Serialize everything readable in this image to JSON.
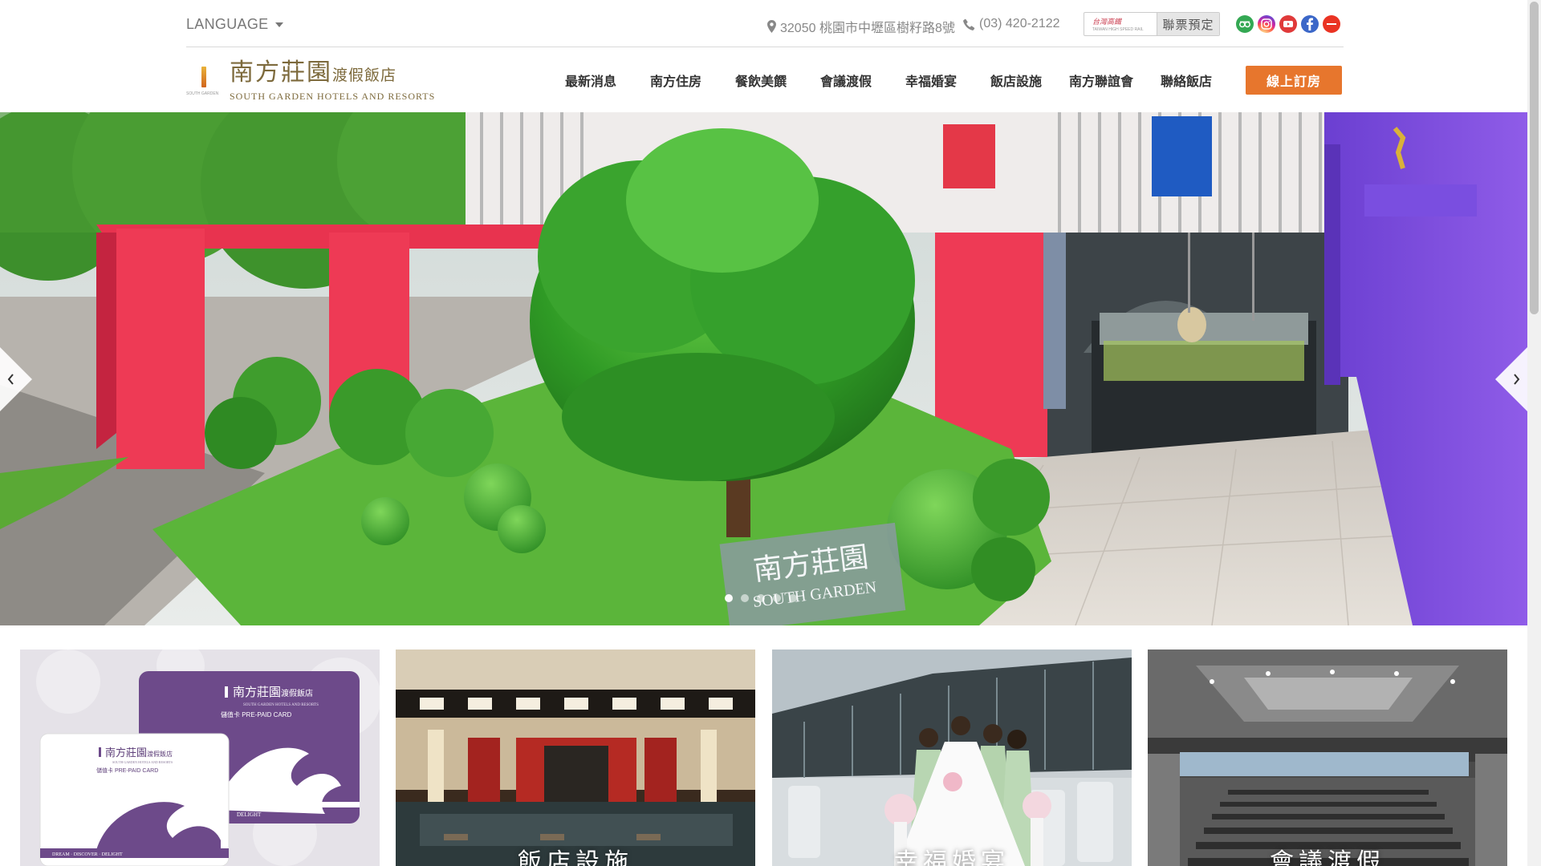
{
  "header": {
    "language_label": "LANGUAGE",
    "address": "32050 桃園市中壢區樹籽路8號",
    "phone": "(03) 420-2122",
    "thsr_logo_text": "台灣高鐵",
    "thsr_logo_en": "TAIWAN HIGH SPEED RAIL",
    "thsr_button_label": "聯票預定",
    "socials": [
      "tripadvisor-icon",
      "instagram-icon",
      "youtube-icon",
      "facebook-icon",
      "weibo-icon"
    ]
  },
  "brand": {
    "name_cn": "南方莊園",
    "name_cn_suffix": "渡假飯店",
    "name_en": "SOUTH GARDEN HOTELS AND RESORTS",
    "mark_caption": "SOUTH GARDEN"
  },
  "nav": {
    "items": [
      "最新消息",
      "南方住房",
      "餐飲美饌",
      "會議渡假",
      "幸福婚宴",
      "飯店設施",
      "南方聯誼會",
      "聯絡飯店"
    ],
    "book_label": "線上訂房"
  },
  "hero": {
    "sign_cn": "南方莊園",
    "sign_en": "SOUTH GARDEN",
    "slide_count": 5,
    "active_slide": 1
  },
  "tiles": [
    {
      "name": "prepaid-card",
      "card_brand": "南方莊園",
      "card_brand_suffix": "渡假飯店",
      "card_subtitle": "儲值卡 PRE-PAID CARD",
      "card_en": "SOUTH GARDEN HOTELS AND RESORTS",
      "card_tagline": "DREAM · DISCOVER · DELIGHT",
      "card_tagline_short": "DELIGHT",
      "caption": ""
    },
    {
      "name": "facilities",
      "caption": "飯店設施"
    },
    {
      "name": "wedding",
      "caption": "幸福婚宴"
    },
    {
      "name": "meeting",
      "caption": "會議渡假"
    }
  ],
  "colors": {
    "accent": "#e7762d",
    "brand_gold": "#7d6a3c",
    "card_purple": "#6d4a8a"
  }
}
